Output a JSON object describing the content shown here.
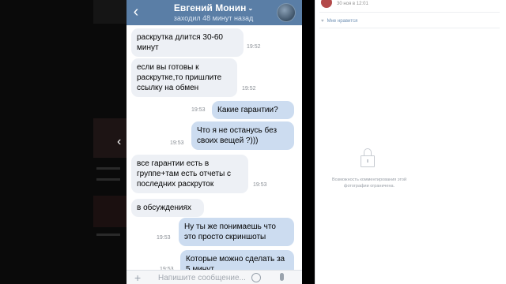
{
  "chat": {
    "contact_name": "Евгений Монин",
    "status": "заходил 48 минут назад",
    "back_glyph": "‹",
    "caret_glyph": "⌄",
    "messages": [
      {
        "dir": "in",
        "text": "раскрутка длится 30-60 минут",
        "time": "19:52"
      },
      {
        "dir": "in",
        "text": "если вы готовы к раскрутке,то пришлите ссылку на обмен",
        "time": "19:52"
      },
      {
        "dir": "out",
        "text": "Какие гарантии?",
        "time": "19:53"
      },
      {
        "dir": "out",
        "text": "Что я не останусь без своих вещей ?)))",
        "time": "19:53"
      },
      {
        "dir": "in",
        "text": "все гарантии есть в группе+там есть отчеты с последних раскруток",
        "time": "19:53"
      },
      {
        "dir": "in",
        "text": "в обсуждениях",
        "time": ""
      },
      {
        "dir": "out",
        "text": "Ну ты же понимаешь что это просто скриншоты",
        "time": "19:53"
      },
      {
        "dir": "out",
        "text": "Которые можно сделать за 5 минут",
        "time": "19:53"
      }
    ],
    "composer_placeholder": "Напишите сообщение...",
    "composer_plus": "+"
  },
  "viewer": {
    "prev_glyph": "‹",
    "next_glyph": "›"
  },
  "panel": {
    "date": "30 ноя в 12:01",
    "like_label": "Мне нравится",
    "heart_glyph": "♥",
    "comments_disabled": "Возможность комментирования этой фотографии ограничена."
  },
  "colors": {
    "header": "#5a7ea6",
    "incoming_bubble": "#edf0f5",
    "outgoing_bubble": "#ccdcf0"
  }
}
